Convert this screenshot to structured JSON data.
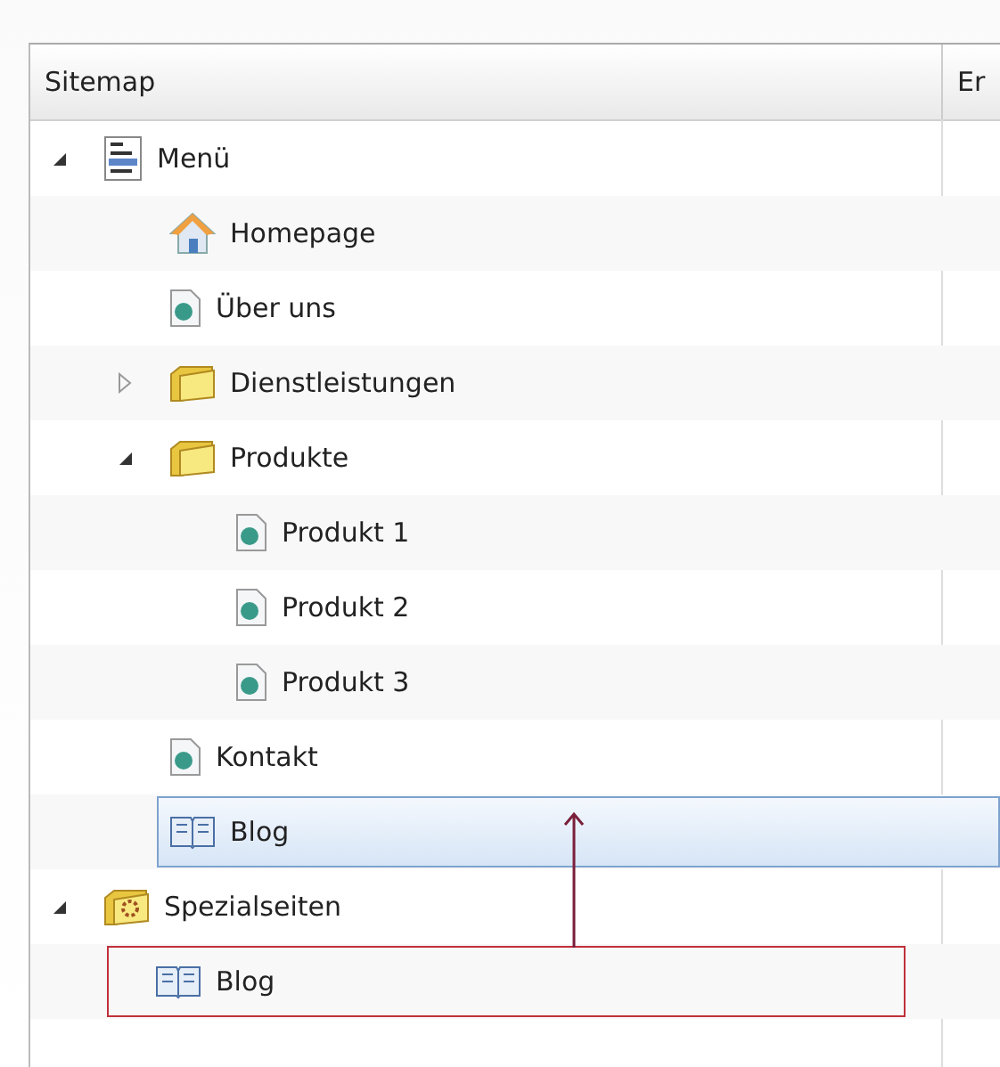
{
  "columns": [
    "Sitemap",
    "Er"
  ],
  "tree": [
    {
      "label": "Menü",
      "kind": "list",
      "expanded": true,
      "selected": false,
      "children": [
        {
          "label": "Homepage",
          "kind": "home",
          "selected": false
        },
        {
          "label": "Über uns",
          "kind": "page",
          "selected": false
        },
        {
          "label": "Dienstleistungen",
          "kind": "folder",
          "expanded": false,
          "selected": false
        },
        {
          "label": "Produkte",
          "kind": "folder",
          "expanded": true,
          "selected": false,
          "children": [
            {
              "label": "Produkt 1",
              "kind": "page",
              "selected": false
            },
            {
              "label": "Produkt 2",
              "kind": "page",
              "selected": false
            },
            {
              "label": "Produkt 3",
              "kind": "page",
              "selected": false
            }
          ]
        },
        {
          "label": "Kontakt",
          "kind": "page",
          "selected": false
        },
        {
          "label": "Blog",
          "kind": "book",
          "selected": true
        }
      ]
    },
    {
      "label": "Spezialseiten",
      "kind": "special-folder",
      "expanded": true,
      "selected": false,
      "children": [
        {
          "label": "Blog",
          "kind": "book",
          "selected": false,
          "outlined": true
        }
      ]
    }
  ]
}
